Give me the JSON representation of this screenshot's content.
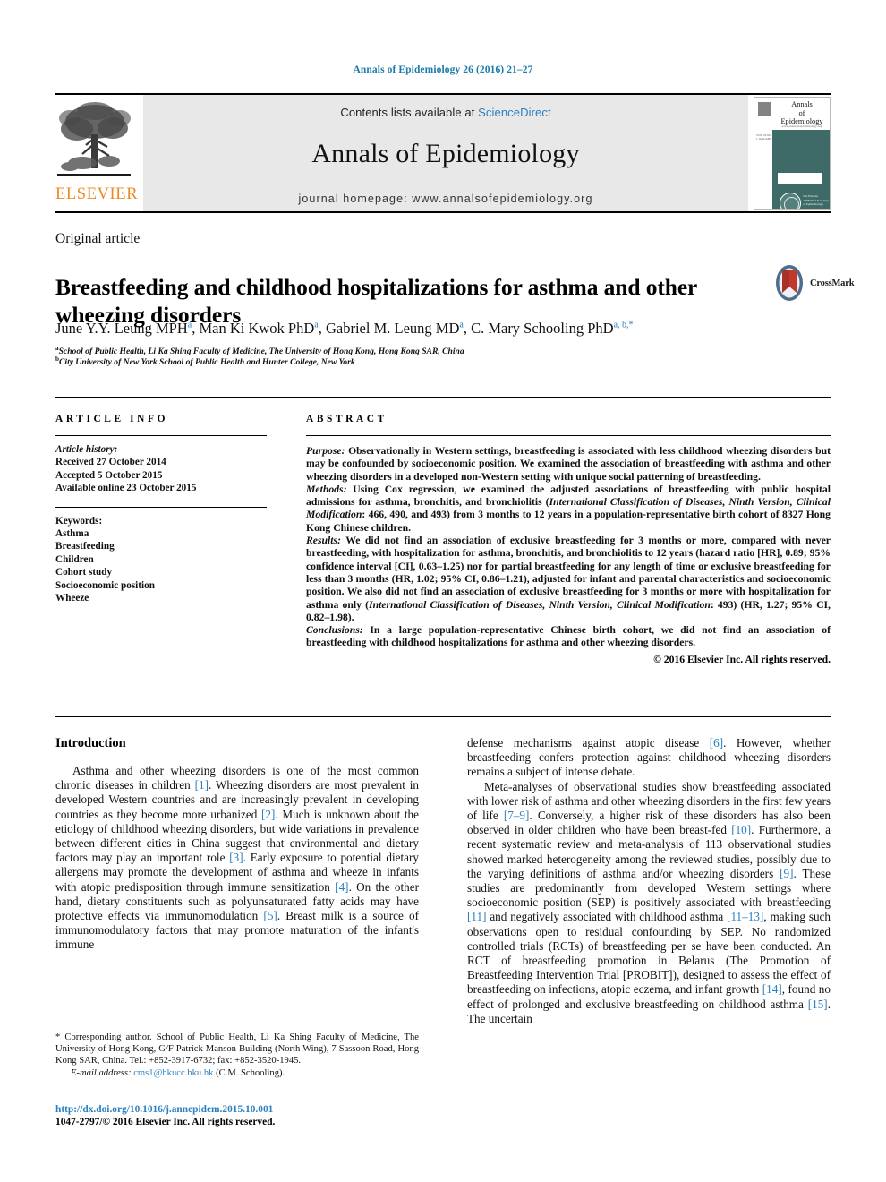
{
  "running_head": "Annals of Epidemiology 26 (2016) 21–27",
  "masthead": {
    "publisher_wordmark": "ELSEVIER",
    "contents_prefix": "Contents lists available at ",
    "contents_link": "ScienceDirect",
    "journal_name": "Annals of Epidemiology",
    "homepage": "journal homepage: www.annalsofepidemiology.org",
    "cover": {
      "title_line1": "Annals",
      "title_line2": "of",
      "title_line3": "Epidemiology",
      "subtitle": "www.annalsofepidemiology.org",
      "strip_text": "VOL. 26  NO. 1\nJANUARY",
      "seal_text": "The Elsevier\nAMERICAN\nCollege of\nEpidemiology"
    }
  },
  "article": {
    "type": "Original article",
    "title": "Breastfeeding and childhood hospitalizations for asthma and other wheezing disorders",
    "crossmark_label": "CrossMark",
    "authors": [
      {
        "name": "June Y.Y. Leung MPH",
        "sup": "a",
        "sep": ", "
      },
      {
        "name": "Man Ki Kwok PhD",
        "sup": "a",
        "sep": ", "
      },
      {
        "name": "Gabriel M. Leung MD",
        "sup": "a",
        "sep": ", "
      },
      {
        "name": "C. Mary Schooling PhD",
        "sup": "a, b,*",
        "sep": ""
      }
    ],
    "affiliations": [
      {
        "marker": "a",
        "text": "School of Public Health, Li Ka Shing Faculty of Medicine, The University of Hong Kong, Hong Kong SAR, China"
      },
      {
        "marker": "b",
        "text": "City University of New York School of Public Health and Hunter College, New York"
      }
    ]
  },
  "info": {
    "heading": "ARTICLE INFO",
    "history_label": "Article history:",
    "history": [
      "Received 27 October 2014",
      "Accepted 5 October 2015",
      "Available online 23 October 2015"
    ],
    "keywords_label": "Keywords:",
    "keywords": [
      "Asthma",
      "Breastfeeding",
      "Children",
      "Cohort study",
      "Socioeconomic position",
      "Wheeze"
    ]
  },
  "abstract": {
    "heading": "ABSTRACT",
    "sections": [
      {
        "label": "Purpose:",
        "text": " Observationally in Western settings, breastfeeding is associated with less childhood wheezing disorders but may be confounded by socioeconomic position. We examined the association of breastfeeding with asthma and other wheezing disorders in a developed non-Western setting with unique social patterning of breastfeeding."
      },
      {
        "label": "Methods:",
        "text": " Using Cox regression, we examined the adjusted associations of breastfeeding with public hospital admissions for asthma, bronchitis, and bronchiolitis (International Classification of Diseases, Ninth Version, Clinical Modification: 466, 490, and 493) from 3 months to 12 years in a population-representative birth cohort of 8327 Hong Kong Chinese children."
      },
      {
        "label": "Results:",
        "text": " We did not find an association of exclusive breastfeeding for 3 months or more, compared with never breastfeeding, with hospitalization for asthma, bronchitis, and bronchiolitis to 12 years (hazard ratio [HR], 0.89; 95% confidence interval [CI], 0.63–1.25) nor for partial breastfeeding for any length of time or exclusive breastfeeding for less than 3 months (HR, 1.02; 95% CI, 0.86–1.21), adjusted for infant and parental characteristics and socioeconomic position. We also did not find an association of exclusive breastfeeding for 3 months or more with hospitalization for asthma only (International Classification of Diseases, Ninth Version, Clinical Modification: 493) (HR, 1.27; 95% CI, 0.82–1.98)."
      },
      {
        "label": "Conclusions:",
        "text": " In a large population-representative Chinese birth cohort, we did not find an association of breastfeeding with childhood hospitalizations for asthma and other wheezing disorders."
      }
    ],
    "copyright": "© 2016 Elsevier Inc. All rights reserved."
  },
  "body": {
    "intro_heading": "Introduction",
    "left_paragraphs": [
      "Asthma and other wheezing disorders is one of the most common chronic diseases in children [1]. Wheezing disorders are most prevalent in developed Western countries and are increasingly prevalent in developing countries as they become more urbanized [2]. Much is unknown about the etiology of childhood wheezing disorders, but wide variations in prevalence between different cities in China suggest that environmental and dietary factors may play an important role [3]. Early exposure to potential dietary allergens may promote the development of asthma and wheeze in infants with atopic predisposition through immune sensitization [4]. On the other hand, dietary constituents such as polyunsaturated fatty acids may have protective effects via immunomodulation [5]. Breast milk is a source of immunomodulatory factors that may promote maturation of the infant's immune"
    ],
    "right_paragraphs": [
      "defense mechanisms against atopic disease [6]. However, whether breastfeeding confers protection against childhood wheezing disorders remains a subject of intense debate.",
      "Meta-analyses of observational studies show breastfeeding associated with lower risk of asthma and other wheezing disorders in the first few years of life [7–9]. Conversely, a higher risk of these disorders has also been observed in older children who have been breast-fed [10]. Furthermore, a recent systematic review and meta-analysis of 113 observational studies showed marked heterogeneity among the reviewed studies, possibly due to the varying definitions of asthma and/or wheezing disorders [9]. These studies are predominantly from developed Western settings where socioeconomic position (SEP) is positively associated with breastfeeding [11] and negatively associated with childhood asthma [11–13], making such observations open to residual confounding by SEP. No randomized controlled trials (RCTs) of breastfeeding per se have been conducted. An RCT of breastfeeding promotion in Belarus (The Promotion of Breastfeeding Intervention Trial [PROBIT]), designed to assess the effect of breastfeeding on infections, atopic eczema, and infant growth [14], found no effect of prolonged and exclusive breastfeeding on childhood asthma [15]. The uncertain"
    ]
  },
  "footnote": {
    "corresponding": "* Corresponding author. School of Public Health, Li Ka Shing Faculty of Medicine, The University of Hong Kong, G/F Patrick Manson Building (North Wing), 7 Sassoon Road, Hong Kong SAR, China. Tel.: +852-3917-6732; fax: +852-3520-1945.",
    "email_label": "E-mail address:",
    "email": "cms1@hkucc.hku.hk",
    "email_suffix": " (C.M. Schooling).",
    "doi": "http://dx.doi.org/10.1016/j.annepidem.2015.10.001",
    "issn_line": "1047-2797/© 2016 Elsevier Inc. All rights reserved."
  },
  "colors": {
    "link_blue": "#2a7fc0",
    "head_blue": "#1a7aa8",
    "elsevier_orange": "#ea8b1f",
    "cover_teal": "#3e6a67"
  }
}
